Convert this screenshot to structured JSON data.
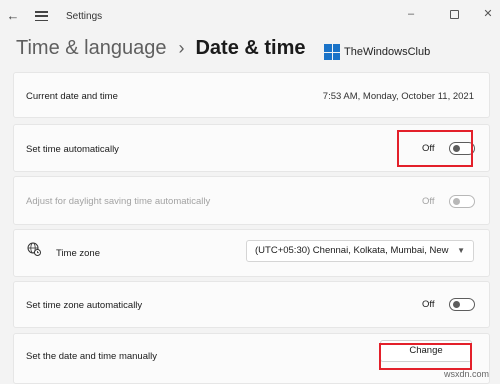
{
  "window": {
    "title": "Settings"
  },
  "breadcrumb": {
    "parent": "Time & language",
    "separator": "›",
    "current": "Date & time"
  },
  "watermark": {
    "logo_text": "TheWindowsClub",
    "site": "wsxdn.com"
  },
  "current_datetime": {
    "label": "Current date and time",
    "value": "7:53 AM, Monday, October 11, 2021"
  },
  "set_time_auto": {
    "label": "Set time automatically",
    "state": "Off"
  },
  "daylight_saving": {
    "label": "Adjust for daylight saving time automatically",
    "state": "Off"
  },
  "time_zone": {
    "label": "Time zone",
    "selected": "(UTC+05:30) Chennai, Kolkata, Mumbai, New"
  },
  "set_time_zone_auto": {
    "label": "Set time zone automatically",
    "state": "Off"
  },
  "manual": {
    "label": "Set the date and time manually",
    "button": "Change"
  },
  "colors": {
    "highlight": "#e3202a",
    "logo": "#1a73c8"
  },
  "icons": {
    "back": "back-arrow-icon",
    "menu": "hamburger-icon",
    "timezone": "globe-clock-icon"
  }
}
